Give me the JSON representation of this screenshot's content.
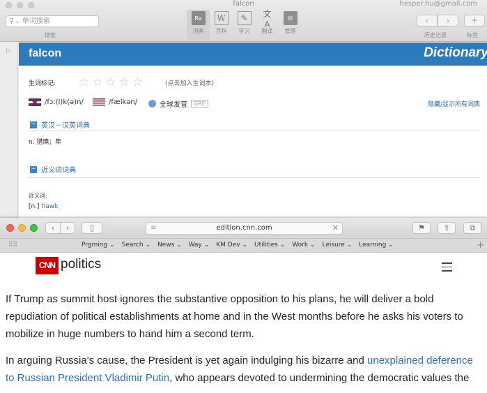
{
  "dictionary": {
    "window_title": "falcon",
    "account": "hesper.hu@gmail.com",
    "search_placeholder": "单词搜索",
    "search_caption": "搜索",
    "tools": [
      {
        "label": "词典",
        "icon": "dictionary-icon"
      },
      {
        "label": "百科",
        "icon": "encyclopedia-icon"
      },
      {
        "label": "学习",
        "icon": "study-icon"
      },
      {
        "label": "翻译",
        "icon": "translate-icon"
      },
      {
        "label": "管理",
        "icon": "manage-icon"
      }
    ],
    "history_caption": "历史记录",
    "tag_caption": "标签",
    "headword": "falcon",
    "brand": "Dictionary",
    "mark_label": "生词标记:",
    "mark_hint": "(点击加入生词本)",
    "uk_phonetic": "/fɔː(l)k(ə)n/",
    "us_phonetic": "/fælkən/",
    "global_pron": "全球发音",
    "gre_badge": "GRE",
    "hide_show_all": "隐藏/显示所有词典",
    "section1_title": "英汉－汉英词典",
    "section1_def": "n. 猎鹰；隼",
    "section2_title": "近义词词典",
    "synonyms_label": "近义词:",
    "synonym_pos": "[n.]",
    "synonym_word": "hawk"
  },
  "safari": {
    "url": "edition.cnn.com",
    "bookmarks": [
      "Prgming ⌄",
      "Search ⌄",
      "News ⌄",
      "Way ⌄",
      "KM Dev ⌄",
      "Utilities ⌄",
      "Work ⌄",
      "Leisure ⌄",
      "Learning ⌄"
    ],
    "cnn_logo": "CNN",
    "section_name": "politics",
    "paragraph1": "If Trump as summit host ignores the substantive opposition to his plans, he will deliver a bold repudiation of political establishments at home and in the West months before he asks his voters to mobilize in huge numbers to hand him a second term.",
    "paragraph2_start": "In arguing Russia's cause, the President is yet again indulging his bizarre and ",
    "paragraph2_link": "unexplained deference to Russian President Vladimir Putin",
    "paragraph2_end": ", who appears devoted to undermining the democratic values the"
  }
}
